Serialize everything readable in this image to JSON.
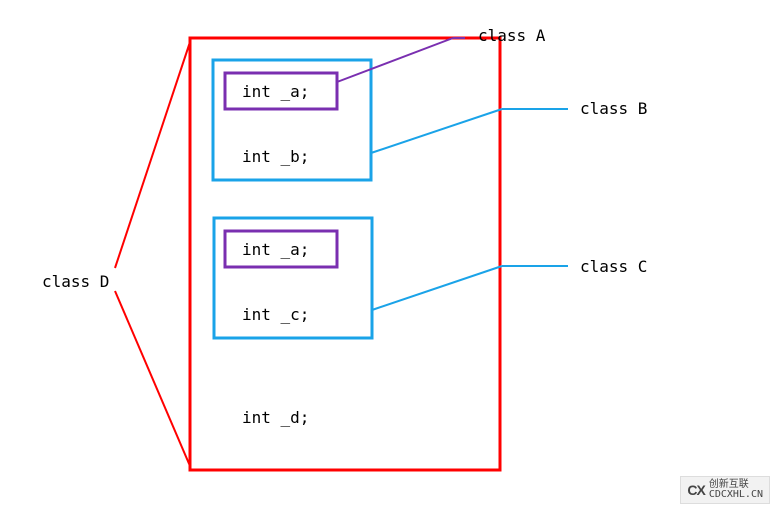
{
  "labels": {
    "classA": "class A",
    "classB": "class B",
    "classC": "class C",
    "classD": "class D"
  },
  "members": {
    "a1": "int _a;",
    "b": "int _b;",
    "a2": "int _a;",
    "c": "int _c;",
    "d": "int _d;"
  },
  "watermark": {
    "logo": "CX",
    "line1": "创新互联",
    "line2": "CDCXHL.CN"
  },
  "colors": {
    "red": "#ff0000",
    "blue": "#1aa3e8",
    "purple": "#7a2fb0",
    "black": "#000000"
  }
}
